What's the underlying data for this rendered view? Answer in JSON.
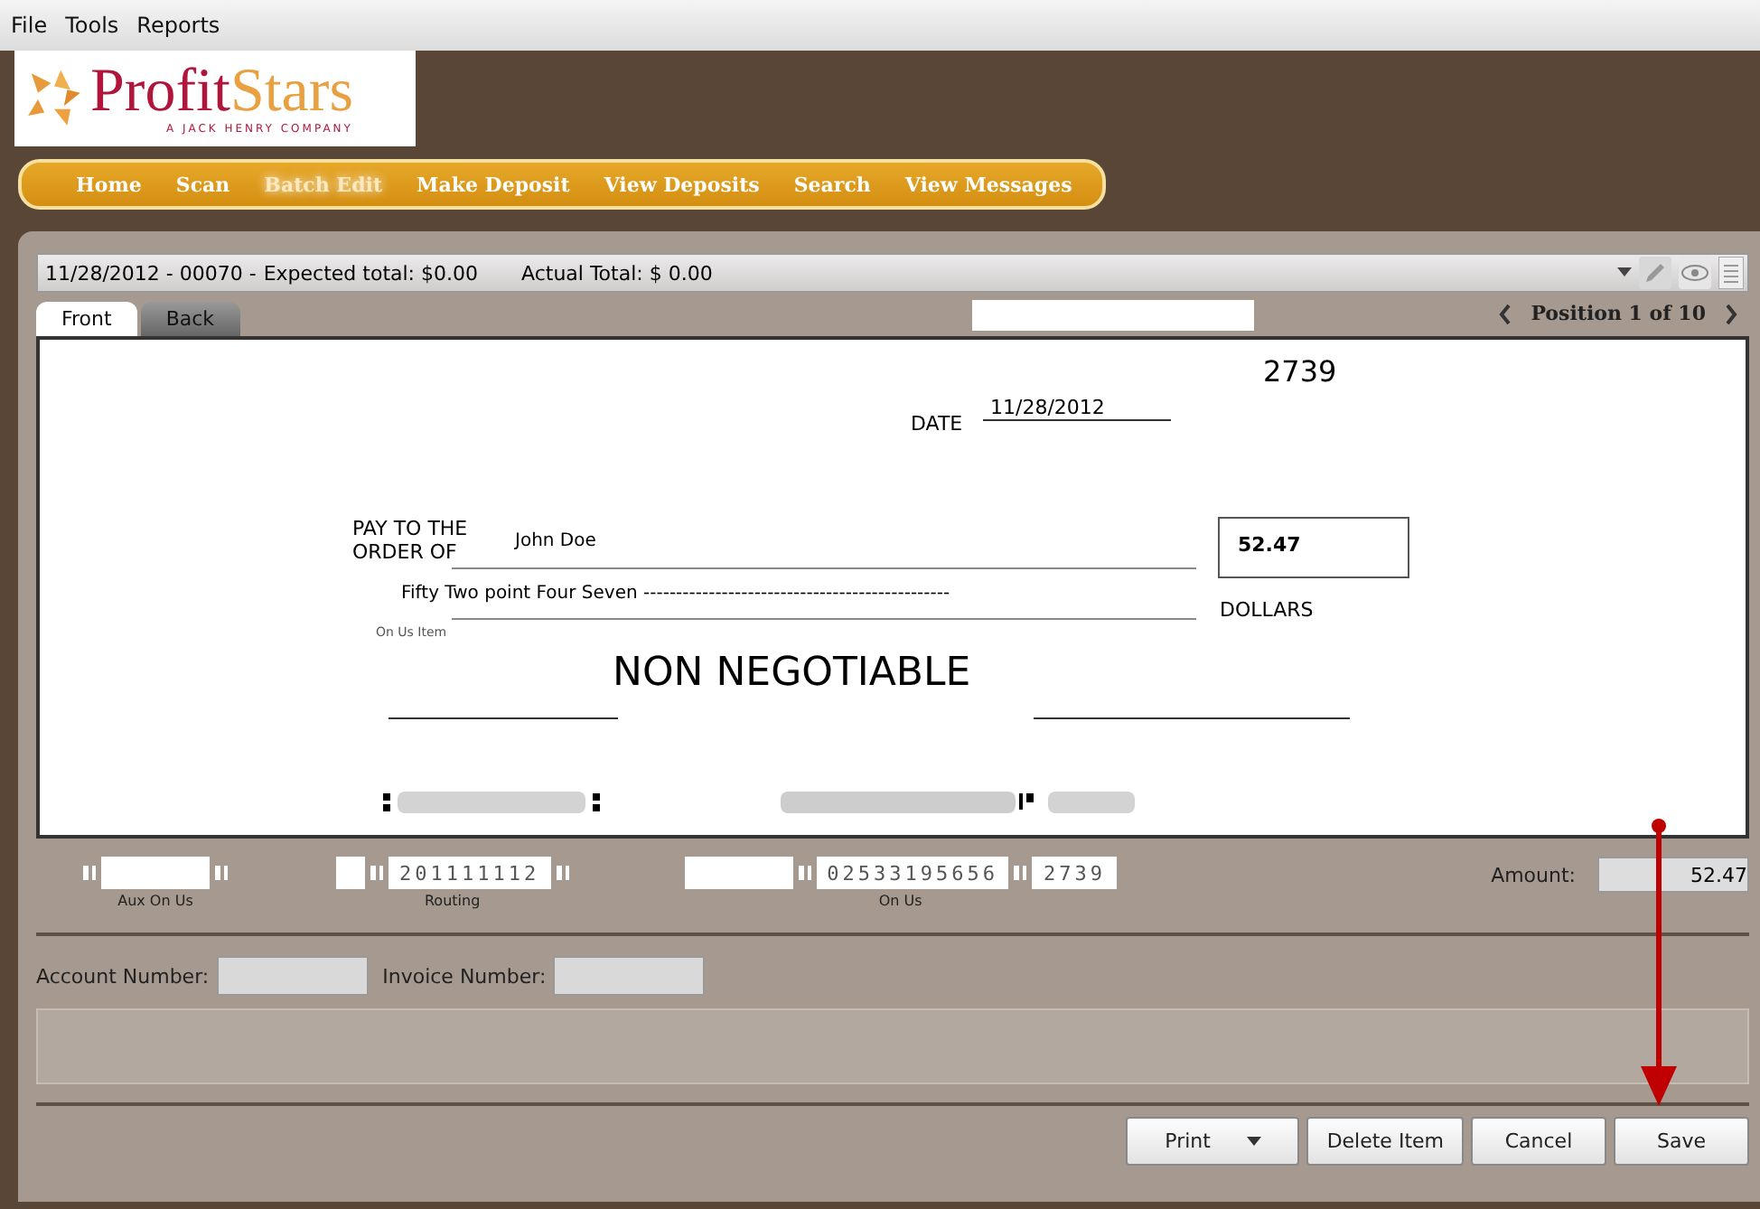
{
  "menu": [
    "File",
    "Tools",
    "Reports"
  ],
  "logo": {
    "word_1": "Profit",
    "word_2": "Stars",
    "tagline": "A JACK HENRY COMPANY"
  },
  "nav": [
    {
      "label": "Home",
      "selected": false
    },
    {
      "label": "Scan",
      "selected": false
    },
    {
      "label": "Batch Edit",
      "selected": true
    },
    {
      "label": "Make Deposit",
      "selected": false
    },
    {
      "label": "View Deposits",
      "selected": false
    },
    {
      "label": "Search",
      "selected": false
    },
    {
      "label": "View Messages",
      "selected": false
    }
  ],
  "batch_bar": {
    "batch": "11/28/2012 - 00070 -",
    "expected": "Expected total: $0.00",
    "actual": "Actual Total: $ 0.00"
  },
  "tabs": [
    {
      "label": "Front",
      "selected": true
    },
    {
      "label": "Back",
      "selected": false
    }
  ],
  "position": "Position 1 of 10",
  "check": {
    "number": "2739",
    "date_label": "DATE",
    "date": "11/28/2012",
    "pay_label_1": "PAY TO THE",
    "pay_label_2": "ORDER OF",
    "payee": "John Doe",
    "amount": "52.47",
    "amount_words": "Fifty Two point Four Seven -----------------------------------------------",
    "dollars": "DOLLARS",
    "on_us_label": "On Us Item",
    "stamp": "NON NEGOTIABLE"
  },
  "micr": {
    "aux_on_us_label": "Aux On Us",
    "routing": "201111112",
    "routing_label": "Routing",
    "on_us": "02533195656",
    "serial": "2739",
    "on_us_label": "On Us",
    "amount_label": "Amount:",
    "amount": "52.47"
  },
  "fields": [
    {
      "label": "Account Number:"
    },
    {
      "label": "Invoice Number:"
    }
  ],
  "buttons": [
    {
      "label": "Print",
      "kind": "dropdown"
    },
    {
      "label": "Delete Item",
      "kind": "plain"
    },
    {
      "label": "Cancel",
      "kind": "plain"
    },
    {
      "label": "Save",
      "kind": "plain"
    }
  ]
}
